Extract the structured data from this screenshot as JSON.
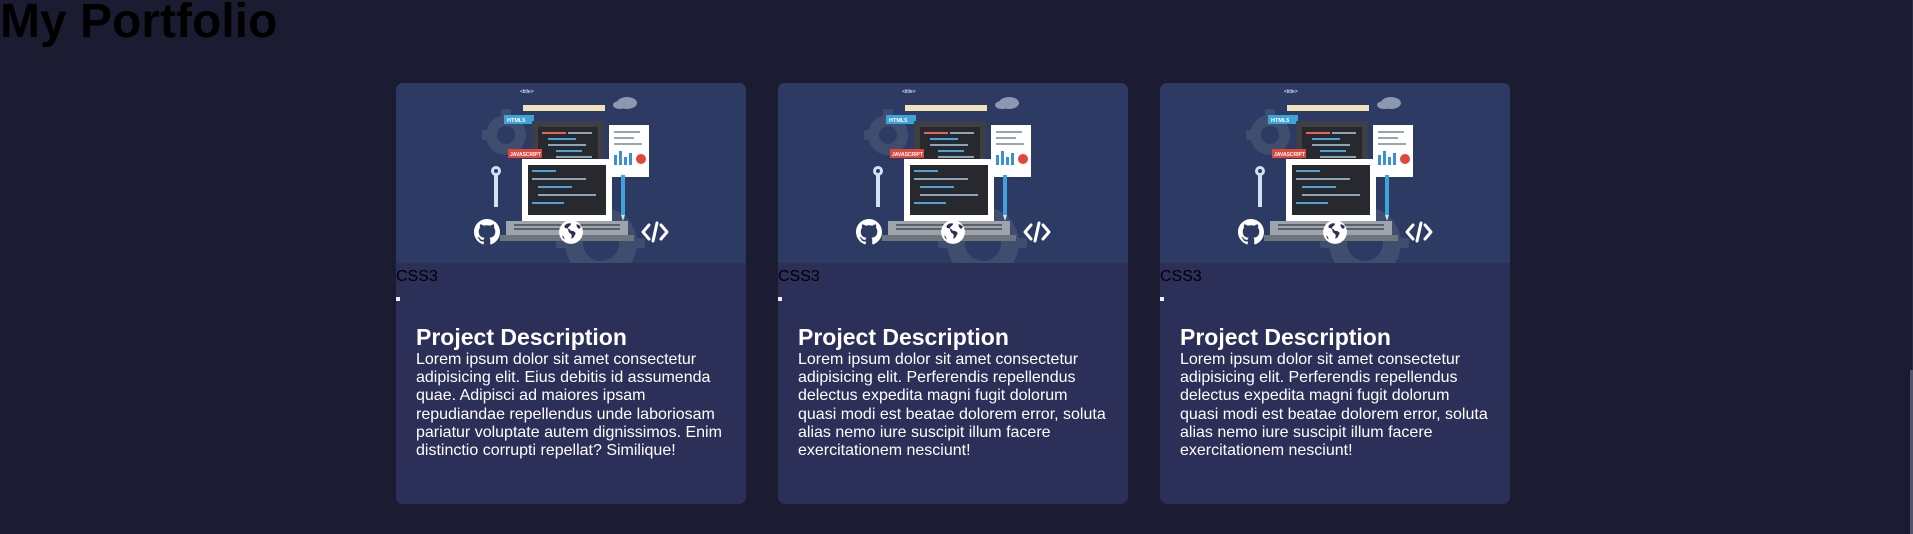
{
  "page": {
    "title": "My Portfolio"
  },
  "colors": {
    "background": "#1b1c32",
    "card": "#2c2f58",
    "hero": "#2d3b64",
    "text": "#ffffff"
  },
  "cards": [
    {
      "title": "Project Description",
      "description": "Lorem ipsum dolor sit amet consectetur adipisicing elit. Eius debitis id assumenda quae. Adipisci ad maiores ipsam repudiandae repellendus unde laboriosam pariatur voluptate autem dignissimos. Enim distinctio corrupti repellat? Similique!",
      "actions": [
        {
          "icon": "github-icon"
        },
        {
          "icon": "globe-icon"
        },
        {
          "icon": "code-icon"
        }
      ]
    },
    {
      "title": "Project Description",
      "description": "Lorem ipsum dolor sit amet consectetur adipisicing elit. Perferendis repellendus delectus expedita magni fugit dolorum quasi modi est beatae dolorem error, soluta alias nemo iure suscipit illum facere exercitationem nesciunt!",
      "actions": [
        {
          "icon": "github-icon"
        },
        {
          "icon": "globe-icon"
        },
        {
          "icon": "code-icon"
        }
      ]
    },
    {
      "title": "Project Description",
      "description": "Lorem ipsum dolor sit amet consectetur adipisicing elit. Perferendis repellendus delectus expedita magni fugit dolorum quasi modi est beatae dolorem error, soluta alias nemo iure suscipit illum facere exercitationem nesciunt!",
      "actions": [
        {
          "icon": "github-icon"
        },
        {
          "icon": "globe-icon"
        },
        {
          "icon": "code-icon"
        }
      ]
    }
  ],
  "illustration": {
    "labels": [
      "<title>",
      "HTML5",
      "<abc>",
      "<script>",
      "JAVASCRIPT",
      "<head>",
      "CSS3",
      "<div>",
      "<button>"
    ]
  }
}
